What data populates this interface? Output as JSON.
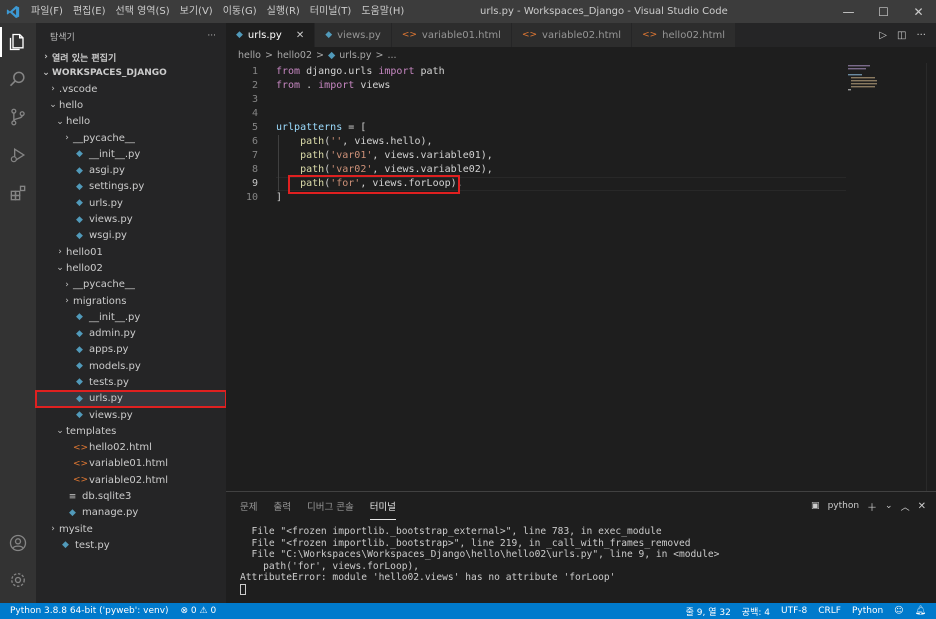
{
  "titlebar": {
    "menu": [
      "파일(F)",
      "편집(E)",
      "선택 영역(S)",
      "보기(V)",
      "이동(G)",
      "실행(R)",
      "터미널(T)",
      "도움말(H)"
    ],
    "title": "urls.py - Workspaces_Django - Visual Studio Code"
  },
  "sidebar": {
    "header": "탐색기",
    "more": "···",
    "open_editors": "열려 있는 편집기",
    "workspace": "WORKSPACES_DJANGO",
    "tree": [
      {
        "label": ".vscode",
        "kind": "folder",
        "expanded": false,
        "depth": 1
      },
      {
        "label": "hello",
        "kind": "folder",
        "expanded": true,
        "depth": 1
      },
      {
        "label": "hello",
        "kind": "folder",
        "expanded": true,
        "depth": 2
      },
      {
        "label": "__pycache__",
        "kind": "folder",
        "expanded": false,
        "depth": 3
      },
      {
        "label": "__init__.py",
        "kind": "py",
        "depth": 3
      },
      {
        "label": "asgi.py",
        "kind": "py",
        "depth": 3
      },
      {
        "label": "settings.py",
        "kind": "py",
        "depth": 3
      },
      {
        "label": "urls.py",
        "kind": "py",
        "depth": 3
      },
      {
        "label": "views.py",
        "kind": "py",
        "depth": 3
      },
      {
        "label": "wsgi.py",
        "kind": "py",
        "depth": 3
      },
      {
        "label": "hello01",
        "kind": "folder",
        "expanded": false,
        "depth": 2
      },
      {
        "label": "hello02",
        "kind": "folder",
        "expanded": true,
        "depth": 2
      },
      {
        "label": "__pycache__",
        "kind": "folder",
        "expanded": false,
        "depth": 3
      },
      {
        "label": "migrations",
        "kind": "folder",
        "expanded": false,
        "depth": 3
      },
      {
        "label": "__init__.py",
        "kind": "py",
        "depth": 3
      },
      {
        "label": "admin.py",
        "kind": "py",
        "depth": 3
      },
      {
        "label": "apps.py",
        "kind": "py",
        "depth": 3
      },
      {
        "label": "models.py",
        "kind": "py",
        "depth": 3
      },
      {
        "label": "tests.py",
        "kind": "py",
        "depth": 3
      },
      {
        "label": "urls.py",
        "kind": "py",
        "depth": 3,
        "selected": true
      },
      {
        "label": "views.py",
        "kind": "py",
        "depth": 3
      },
      {
        "label": "templates",
        "kind": "folder",
        "expanded": true,
        "depth": 2
      },
      {
        "label": "hello02.html",
        "kind": "html",
        "depth": 3
      },
      {
        "label": "variable01.html",
        "kind": "html",
        "depth": 3
      },
      {
        "label": "variable02.html",
        "kind": "html",
        "depth": 3
      },
      {
        "label": "db.sqlite3",
        "kind": "db",
        "depth": 2
      },
      {
        "label": "manage.py",
        "kind": "py",
        "depth": 2
      },
      {
        "label": "mysite",
        "kind": "folder",
        "expanded": false,
        "depth": 1
      },
      {
        "label": "test.py",
        "kind": "py",
        "depth": 1
      }
    ]
  },
  "tabs": [
    {
      "label": "urls.py",
      "kind": "py",
      "active": true,
      "close": "✕"
    },
    {
      "label": "views.py",
      "kind": "py",
      "active": false
    },
    {
      "label": "variable01.html",
      "kind": "html",
      "active": false
    },
    {
      "label": "variable02.html",
      "kind": "html",
      "active": false
    },
    {
      "label": "hello02.html",
      "kind": "html",
      "active": false
    }
  ],
  "breadcrumb": {
    "parts": [
      "hello",
      ">",
      "hello02",
      ">",
      "urls.py",
      ">",
      "..."
    ]
  },
  "editor": {
    "lines": [
      {
        "n": "1",
        "tokens": [
          [
            "kw",
            "from "
          ],
          [
            "plain",
            "django.urls "
          ],
          [
            "kw",
            "import "
          ],
          [
            "plain",
            "path"
          ]
        ]
      },
      {
        "n": "2",
        "tokens": [
          [
            "kw",
            "from "
          ],
          [
            "plain",
            ". "
          ],
          [
            "kw",
            "import "
          ],
          [
            "plain",
            "views"
          ]
        ]
      },
      {
        "n": "3",
        "tokens": []
      },
      {
        "n": "4",
        "tokens": []
      },
      {
        "n": "5",
        "tokens": [
          [
            "var",
            "urlpatterns"
          ],
          [
            "plain",
            " = ["
          ]
        ]
      },
      {
        "n": "6",
        "tokens": [
          [
            "plain",
            "    "
          ],
          [
            "fn",
            "path"
          ],
          [
            "plain",
            "("
          ],
          [
            "str",
            "''"
          ],
          [
            "plain",
            ", "
          ],
          [
            "plain",
            "views.hello),"
          ]
        ]
      },
      {
        "n": "7",
        "tokens": [
          [
            "plain",
            "    "
          ],
          [
            "fn",
            "path"
          ],
          [
            "plain",
            "("
          ],
          [
            "str",
            "'var01'"
          ],
          [
            "plain",
            ", "
          ],
          [
            "plain",
            "views.variable01),"
          ]
        ]
      },
      {
        "n": "8",
        "tokens": [
          [
            "plain",
            "    "
          ],
          [
            "fn",
            "path"
          ],
          [
            "plain",
            "("
          ],
          [
            "str",
            "'var02'"
          ],
          [
            "plain",
            ", "
          ],
          [
            "plain",
            "views.variable02),"
          ]
        ]
      },
      {
        "n": "9",
        "tokens": [
          [
            "plain",
            "    "
          ],
          [
            "fn",
            "path"
          ],
          [
            "plain",
            "("
          ],
          [
            "str",
            "'for'"
          ],
          [
            "plain",
            ", "
          ],
          [
            "plain",
            "views.forLoop),"
          ]
        ]
      },
      {
        "n": "10",
        "tokens": [
          [
            "plain",
            "]"
          ]
        ]
      }
    ]
  },
  "panel": {
    "tabs": [
      "문제",
      "출력",
      "디버그 콘솔",
      "터미널"
    ],
    "active_tab": "터미널",
    "shell": "python",
    "terminal_lines": [
      "  File \"<frozen importlib._bootstrap_external>\", line 783, in exec_module",
      "  File \"<frozen importlib._bootstrap>\", line 219, in _call_with_frames_removed",
      "  File \"C:\\Workspaces\\Workspaces_Django\\hello\\hello02\\urls.py\", line 9, in <module>",
      "    path('for', views.forLoop),",
      "AttributeError: module 'hello02.views' has no attribute 'forLoop'"
    ]
  },
  "statusbar": {
    "interpreter": "Python 3.8.8 64-bit ('pyweb': venv)",
    "problems": "⊗ 0 ⚠ 0",
    "position": "줄 9, 열 32",
    "spaces": "공백: 4",
    "encoding": "UTF-8",
    "eol": "CRLF",
    "language": "Python"
  },
  "colors": {
    "accent": "#007acc",
    "highlight_box": "#e02020"
  }
}
